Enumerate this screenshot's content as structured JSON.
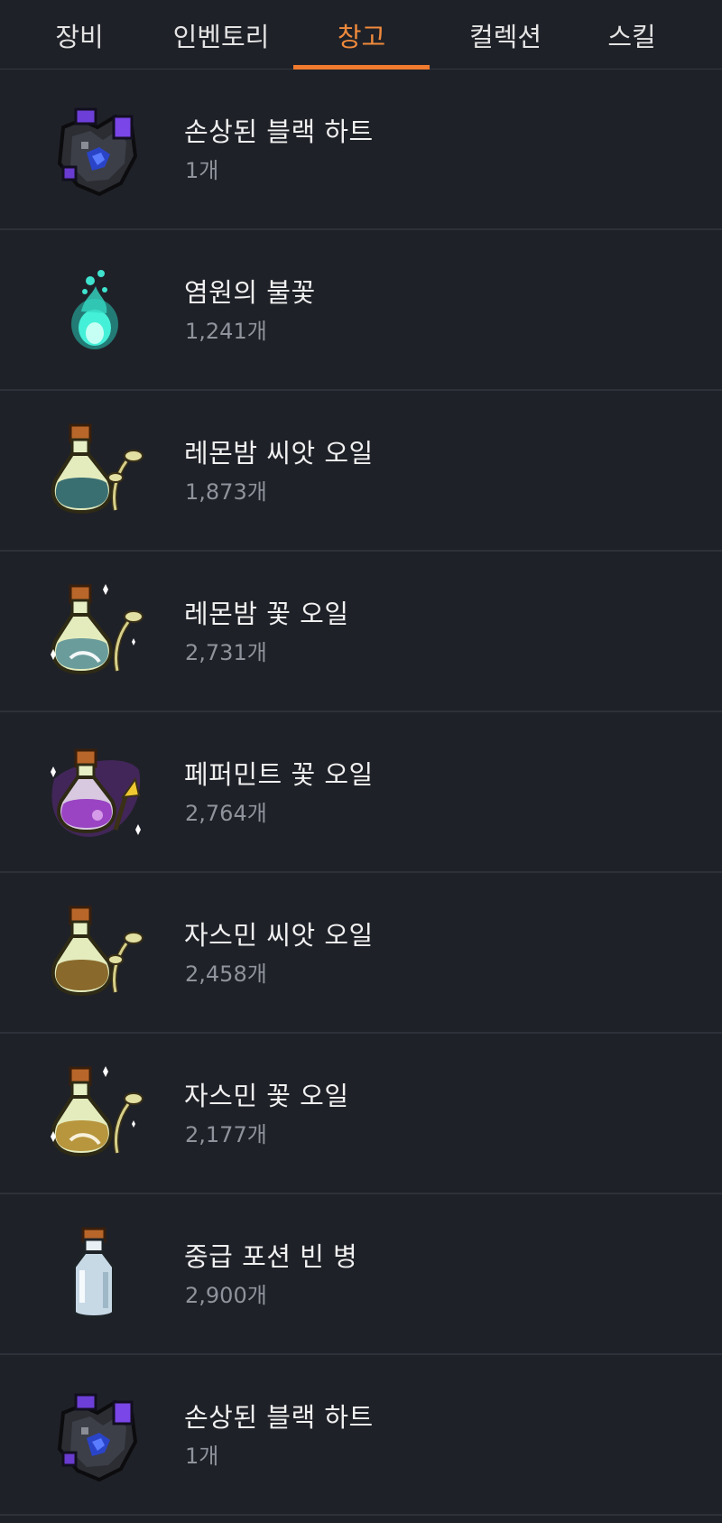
{
  "tabs": [
    {
      "label": "장비"
    },
    {
      "label": "인벤토리"
    },
    {
      "label": "창고"
    },
    {
      "label": "컬렉션"
    },
    {
      "label": "스킬"
    }
  ],
  "active_tab": "창고",
  "accent_color": "#f07a2e",
  "items": [
    {
      "name": "손상된 블랙 하트",
      "count": "1개",
      "icon": "black-heart-icon"
    },
    {
      "name": "염원의 불꽃",
      "count": "1,241개",
      "icon": "flame-icon"
    },
    {
      "name": "레몬밤 씨앗 오일",
      "count": "1,873개",
      "icon": "seed-oil-bottle-icon"
    },
    {
      "name": "레몬밤 꽃 오일",
      "count": "2,731개",
      "icon": "flower-oil-bottle-icon"
    },
    {
      "name": "페퍼민트 꽃 오일",
      "count": "2,764개",
      "icon": "peppermint-oil-bottle-icon"
    },
    {
      "name": "자스민 씨앗 오일",
      "count": "2,458개",
      "icon": "jasmine-seed-oil-bottle-icon"
    },
    {
      "name": "자스민 꽃 오일",
      "count": "2,177개",
      "icon": "jasmine-flower-oil-bottle-icon"
    },
    {
      "name": "중급 포션 빈 병",
      "count": "2,900개",
      "icon": "empty-potion-bottle-icon"
    },
    {
      "name": "손상된 블랙 하트",
      "count": "1개",
      "icon": "black-heart-icon"
    }
  ]
}
